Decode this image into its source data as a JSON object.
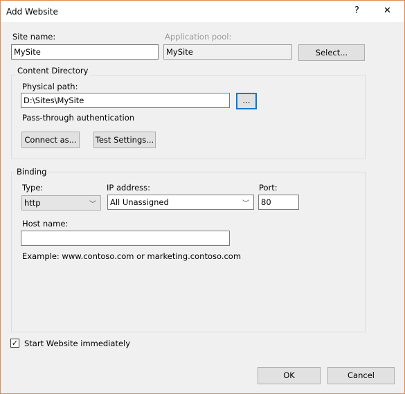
{
  "window": {
    "title": "Add Website",
    "help": "?",
    "close": "✕"
  },
  "site_name": {
    "label": "Site name:",
    "value": "MySite"
  },
  "app_pool": {
    "label": "Application pool:",
    "value": "MySite",
    "select_label": "Select..."
  },
  "content": {
    "group": "Content Directory",
    "path_label": "Physical path:",
    "path_value": "D:\\Sites\\MySite",
    "browse_label": "...",
    "auth_text": "Pass-through authentication",
    "connect_label": "Connect as...",
    "test_label": "Test Settings..."
  },
  "binding": {
    "group": "Binding",
    "type_label": "Type:",
    "type_value": "http",
    "ip_label": "IP address:",
    "ip_value": "All Unassigned",
    "port_label": "Port:",
    "port_value": "80",
    "host_label": "Host name:",
    "host_value": "",
    "example": "Example: www.contoso.com or marketing.contoso.com"
  },
  "start": {
    "label": "Start Website immediately",
    "checked": true
  },
  "buttons": {
    "ok": "OK",
    "cancel": "Cancel"
  },
  "colors": {
    "border": "#e08a4e",
    "focus": "#0078d7"
  }
}
